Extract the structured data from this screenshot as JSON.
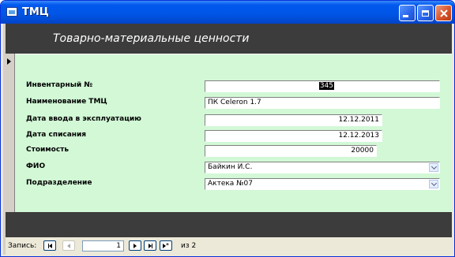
{
  "window": {
    "title": "ТМЦ"
  },
  "form": {
    "header_title": "Товарно-материальные ценности",
    "fields": [
      {
        "label": "Инвентарный №",
        "value": "345"
      },
      {
        "label": "Наименование ТМЦ",
        "value": "ПК Celeron 1.7"
      },
      {
        "label": "Дата ввода в эксплуатацию",
        "value": "12.12.2011"
      },
      {
        "label": "Дата списания",
        "value": "12.12.2013"
      },
      {
        "label": "Стоимость",
        "value": "20000"
      },
      {
        "label": "ФИО",
        "value": "Байкин И.С."
      },
      {
        "label": "Подразделение",
        "value": "Актека №07"
      }
    ]
  },
  "navigation": {
    "label": "Запись:",
    "current": "1",
    "of_text": "из 2"
  },
  "icons": {
    "app": "form-icon",
    "minimize": "minimize-icon",
    "maximize": "maximize-icon",
    "close": "close-icon",
    "record_selector": "record-pointer-icon",
    "combo": "chevron-down-icon",
    "nav_first": "first-record-icon",
    "nav_prev": "previous-record-icon",
    "nav_next": "next-record-icon",
    "nav_last": "last-record-icon",
    "nav_new": "new-record-icon"
  },
  "colors": {
    "detail_background": "#D2F8D6",
    "header_background": "#3C3C3C",
    "titlebar": "#0055E5"
  }
}
